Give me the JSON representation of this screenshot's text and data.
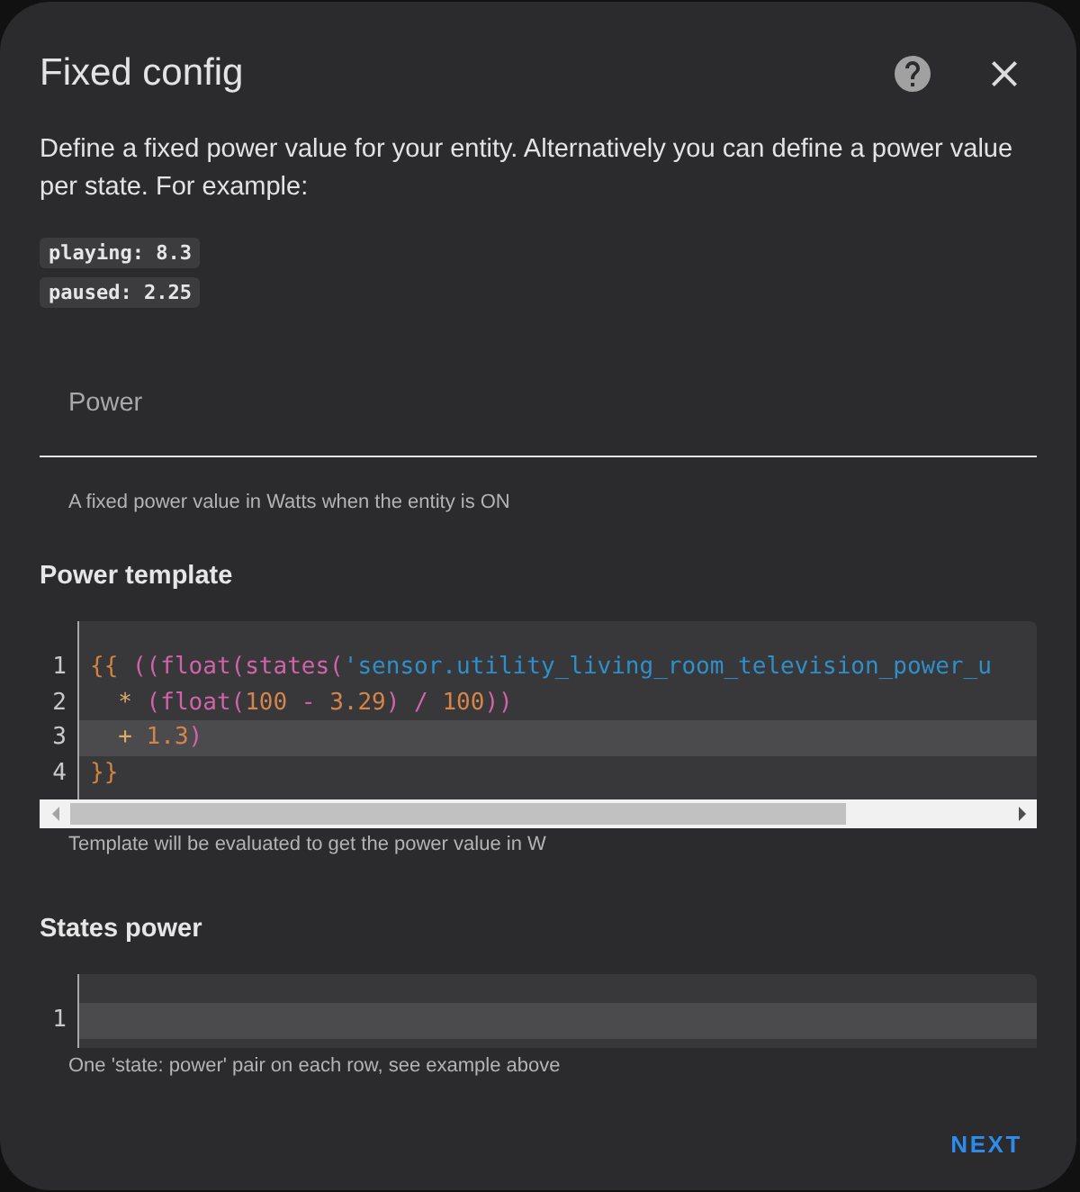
{
  "dialog": {
    "title": "Fixed config",
    "description": "Define a fixed power value for your entity. Alternatively you can define a power value per state. For example:",
    "examples": [
      "playing: 8.3",
      "paused: 2.25"
    ],
    "actions": [
      "NEXT"
    ]
  },
  "power_field": {
    "label": "Power",
    "helper": "A fixed power value in Watts when the entity is ON"
  },
  "power_template": {
    "heading": "Power template",
    "editor": {
      "lines": [
        {
          "number": "1",
          "active": false,
          "tokens": [
            {
              "kind": "brace",
              "text": "{{"
            },
            {
              "kind": "paren",
              "text": " ((float(states("
            },
            {
              "kind": "string",
              "text": "'sensor.utility_living_room_television_power_u"
            }
          ]
        },
        {
          "number": "2",
          "active": false,
          "tokens": [
            {
              "kind": "operator",
              "text": "  *"
            },
            {
              "kind": "paren",
              "text": " (float("
            },
            {
              "kind": "number",
              "text": "100"
            },
            {
              "kind": "paren",
              "text": " - "
            },
            {
              "kind": "number",
              "text": "3.29"
            },
            {
              "kind": "paren",
              "text": ") / "
            },
            {
              "kind": "number",
              "text": "100"
            },
            {
              "kind": "paren",
              "text": "))"
            }
          ]
        },
        {
          "number": "3",
          "active": true,
          "tokens": [
            {
              "kind": "operator",
              "text": "  +"
            },
            {
              "kind": "number",
              "text": " 1.3"
            },
            {
              "kind": "paren",
              "text": ")"
            }
          ]
        },
        {
          "number": "4",
          "active": false,
          "tokens": [
            {
              "kind": "brace",
              "text": "}}"
            }
          ]
        }
      ]
    },
    "helper": "Template will be evaluated to get the power value in W"
  },
  "states_power": {
    "heading": "States power",
    "editor": {
      "lines": [
        {
          "number": "1",
          "active": true
        }
      ]
    },
    "helper": "One 'state: power' pair on each row, see example above"
  }
}
